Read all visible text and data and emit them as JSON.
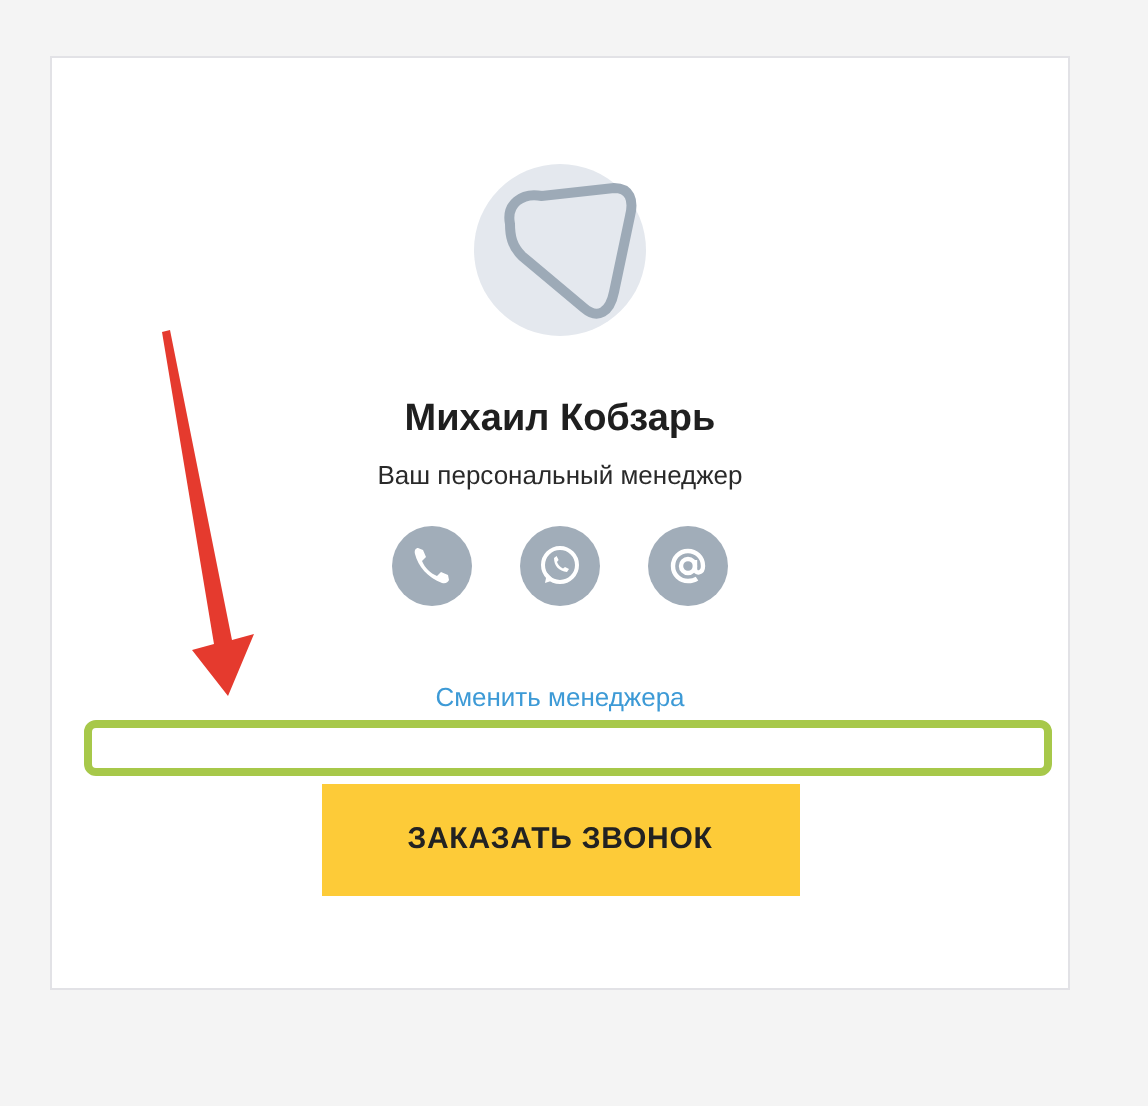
{
  "manager": {
    "name": "Михаил Кобзарь",
    "role": "Ваш персональный менеджер"
  },
  "contacts": [
    {
      "kind": "phone"
    },
    {
      "kind": "whatsapp"
    },
    {
      "kind": "email"
    }
  ],
  "change_link": "Сменить менеджера",
  "call_button": "ЗАКАЗАТЬ ЗВОНОК"
}
